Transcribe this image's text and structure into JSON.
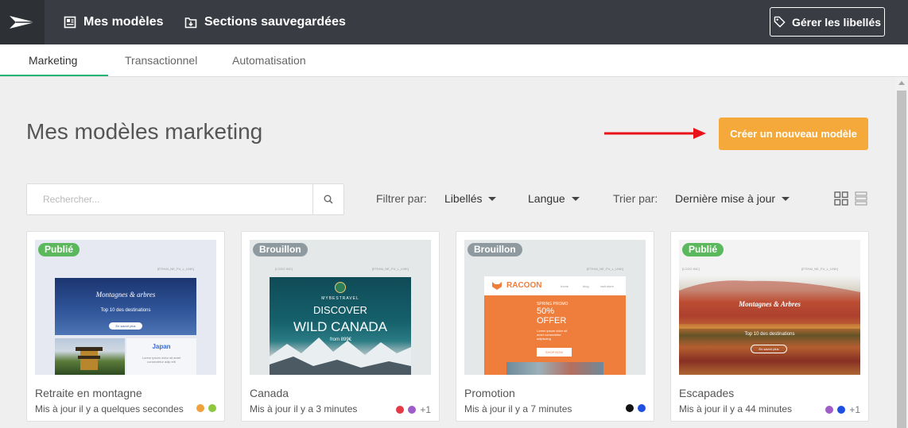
{
  "header": {
    "nav": [
      {
        "label": "Mes modèles",
        "icon": "templates-icon"
      },
      {
        "label": "Sections sauvegardées",
        "icon": "saved-sections-icon"
      }
    ],
    "manage_labels": "Gérer les libellés"
  },
  "tabs": [
    "Marketing",
    "Transactionnel",
    "Automatisation"
  ],
  "page_title": "Mes modèles marketing",
  "create_button": "Créer un nouveau modèle",
  "search": {
    "placeholder": "Rechercher..."
  },
  "filters": {
    "filter_label": "Filtrer par:",
    "labels_dropdown": "Libellés",
    "language_dropdown": "Langue",
    "sort_label": "Trier par:",
    "sort_dropdown": "Dernière mise à jour"
  },
  "colors": {
    "accent": "#f6a93b",
    "published": "#5cb85c",
    "draft": "#8e9a9f",
    "topbar": "#393d43",
    "tab_underline": "#22b573"
  },
  "cards": [
    {
      "name": "Retraite en montagne",
      "status": "Publié",
      "updated": "Mis à jour il y a quelques secondes",
      "dots": [
        "#f0a13a",
        "#8dc63f"
      ],
      "more": "",
      "preview": {
        "view_link": "[ETIHAI_NE_FU_L_LINK]",
        "title": "Montagnes & arbres",
        "subtitle": "Top 10 des destinations",
        "cta": "En savoir plus",
        "side_title": "Japan",
        "side_text": "Lorem ipsum dolor sit amet consectetur adip elit"
      }
    },
    {
      "name": "Canada",
      "status": "Brouillon",
      "updated": "Mis à jour il y a 3 minutes",
      "dots": [
        "#e63946",
        "#a05cc8"
      ],
      "more": "+1",
      "preview": {
        "left_link": "[LOGO INC]",
        "view_link": "[ETIHAI_NE_FU_L_LINK]",
        "brand": "MYBESTRAVEL",
        "title": "DISCOVER",
        "title2": "WILD CANADA",
        "price": "from 899€"
      }
    },
    {
      "name": "Promotion",
      "status": "Brouillon",
      "updated": "Mis à jour il y a 7 minutes",
      "dots": [
        "#111111",
        "#1f4fe0"
      ],
      "more": "",
      "preview": {
        "view_link": "[ETIHAI_NE_FU_L_LINK]",
        "brand": "RACOON",
        "menu": [
          "home",
          "blog",
          "visit store"
        ],
        "promo": "SPRING PROMO",
        "title": "50%",
        "title2": "OFFER",
        "text": "Lorem ipsum dolor sit amet consectetur adipiscing",
        "cta": "SHOP NOW"
      }
    },
    {
      "name": "Escapades",
      "status": "Publié",
      "updated": "Mis à jour il y a 44 minutes",
      "dots": [
        "#a05cc8",
        "#1f4fe0"
      ],
      "more": "+1",
      "preview": {
        "left_link": "[LOGO INC]",
        "view_link": "[ETIHAI_NE_FU_L_LINK]",
        "title": "Montagnes & Arbres",
        "subtitle": "Top 10 des destinations",
        "cta": "En savoir plus"
      }
    }
  ]
}
